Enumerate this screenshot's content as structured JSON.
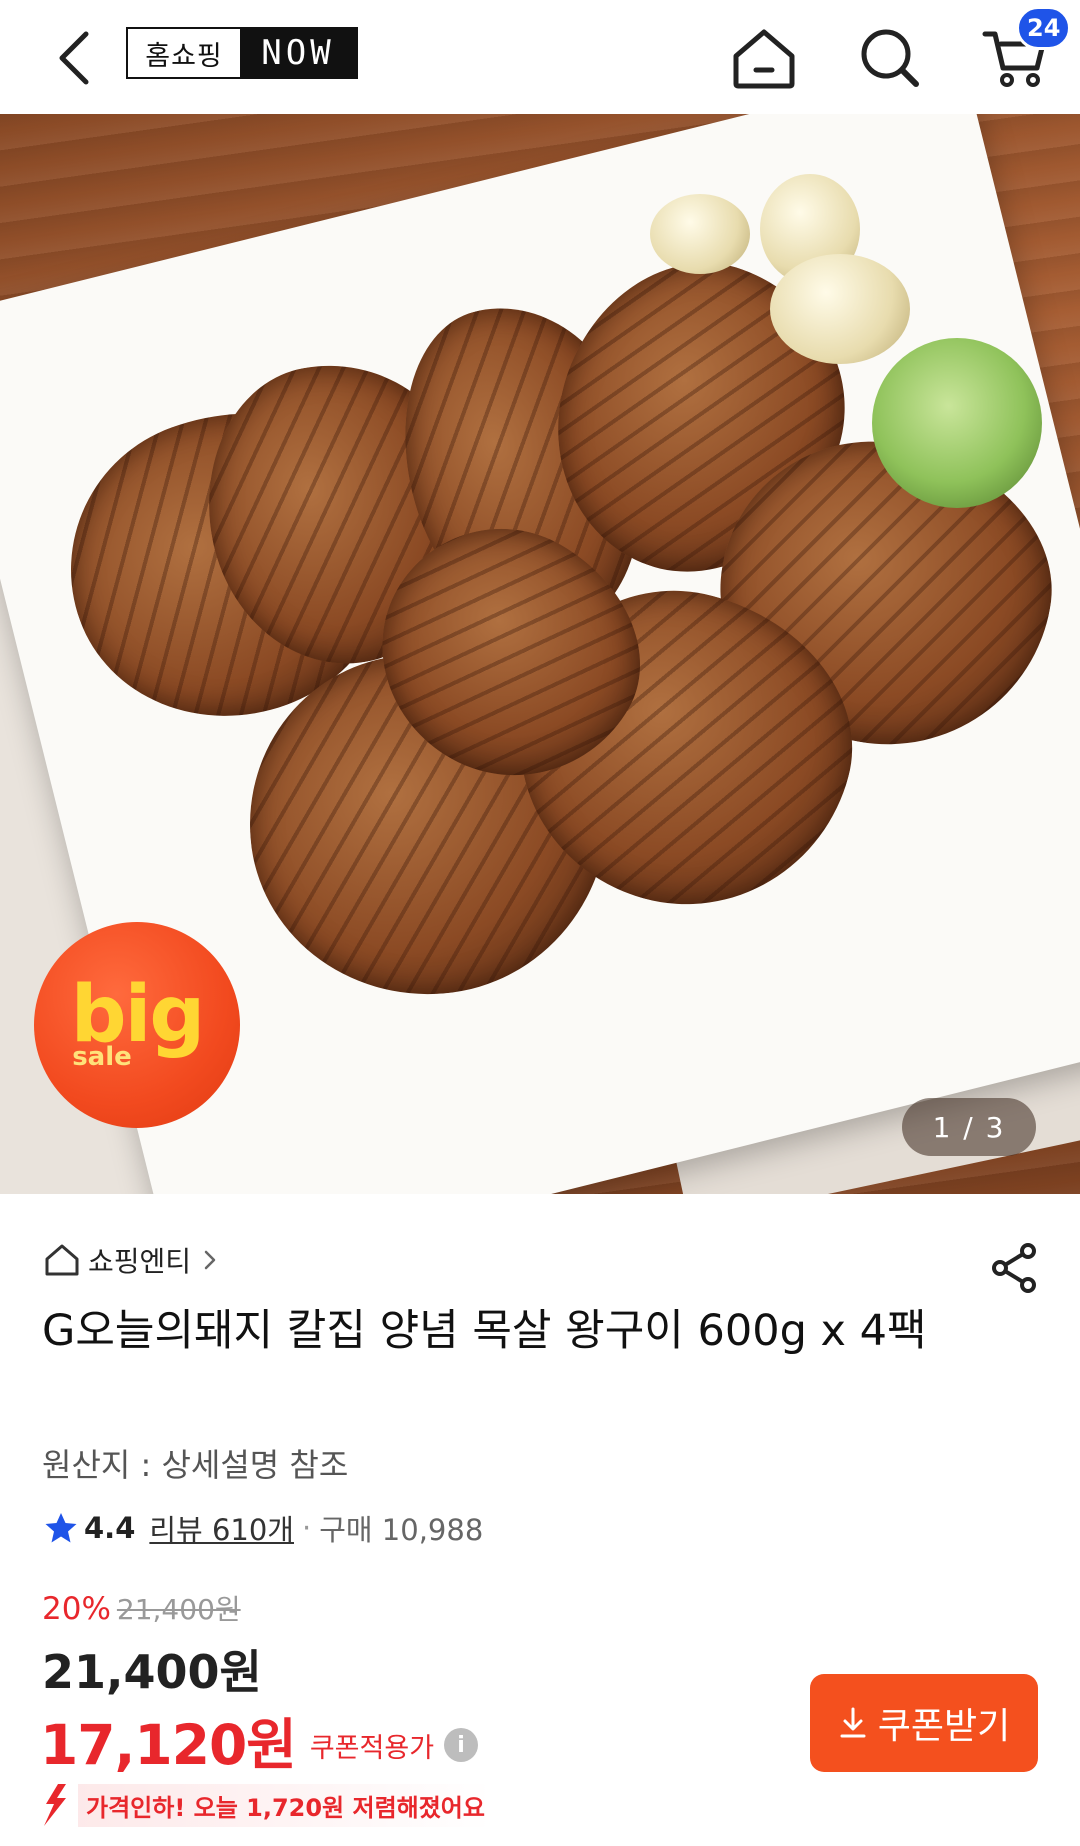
{
  "header": {
    "logo_left": "홈쇼핑",
    "logo_right": "NOW",
    "cart_count": "24"
  },
  "hero": {
    "badge_big": "big",
    "badge_sale": "sale",
    "page_indicator": "1 / 3"
  },
  "product": {
    "seller": "쇼핑엔티",
    "title": "G오늘의돼지 칼집 양념 목살 왕구이 600g x 4팩",
    "origin": "원산지 : 상세설명 참조",
    "rating": "4.4",
    "review_label": "리뷰 610개",
    "purchase_label": "구매 10,988",
    "discount_pct": "20%",
    "original_price": "21,400원",
    "price": "21,400원",
    "coupon_price": "17,120원",
    "coupon_price_label": "쿠폰적용가",
    "coupon_button_label": "쿠폰받기",
    "price_drop_text": "가격인하! 오늘 1,720원 저렴해졌어요"
  },
  "colors": {
    "accent_red": "#e8272c",
    "coupon_button": "#f4501e",
    "badge_blue": "#1f54e8",
    "star_blue": "#1f54e8"
  }
}
